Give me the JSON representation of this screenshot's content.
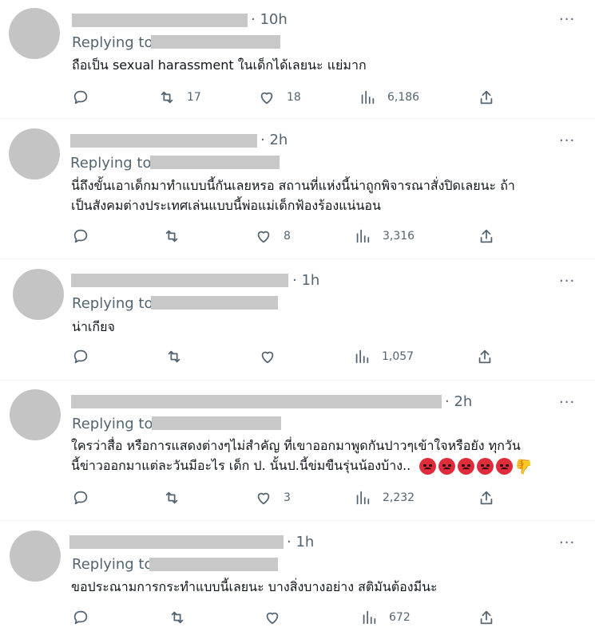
{
  "tweets": [
    {
      "time": "· 10h",
      "replying": "Replying to",
      "lines": [
        "ถือเป็น sexual harassment ในเด็กได้เลยนะ แย่มาก"
      ],
      "retweets": "17",
      "likes": "18",
      "views": "6,186"
    },
    {
      "time": "· 2h",
      "replying": "Replying to",
      "lines": [
        "นี่ถึงขั้นเอาเด็กมาทำแบบนี้กันเลยหรอ สถานที่แห่งนี้น่าถูกพิจารณาสั่งปิดเลยนะ ถ้า",
        "เป็นสังคมต่างประเทศเล่นแบบนี้พ่อแม่เด็กฟ้องร้องแน่นอน"
      ],
      "retweets": "",
      "likes": "8",
      "views": "3,316"
    },
    {
      "time": "· 1h",
      "replying": "Replying to",
      "lines": [
        "น่าเกียจ"
      ],
      "retweets": "",
      "likes": "",
      "views": "1,057"
    },
    {
      "time": "· 2h",
      "replying": "Replying to",
      "lines": [
        "ใครว่าสื่อ หรือการแสดงต่างๆไม่สำคัญ  ที่เขาออกมาพูดกันปาวๆเข้าใจหรือยัง  ทุกวัน",
        "นี้ข่าวออกมาแต่ละวันมีอะไร เด็ก ป. นั้นป.นี้ข่มขืนรุ่นน้องบ้าง.."
      ],
      "retweets": "",
      "likes": "3",
      "views": "2,232"
    },
    {
      "time": "· 1h",
      "replying": "Replying to",
      "lines": [
        "ขอประณามการกระทำแบบนี้เลยนะ บางสิ่งบางอย่าง สติมันต้องมีนะ"
      ],
      "retweets": "",
      "likes": "",
      "views": "672"
    }
  ],
  "more_glyph": "···",
  "icons": [
    "reply-icon",
    "retweet-icon",
    "heart-icon",
    "views-icon",
    "share-icon"
  ],
  "colors": {
    "muted": "#536471",
    "text": "#0f1419",
    "redaction": "#c8c8c8"
  }
}
